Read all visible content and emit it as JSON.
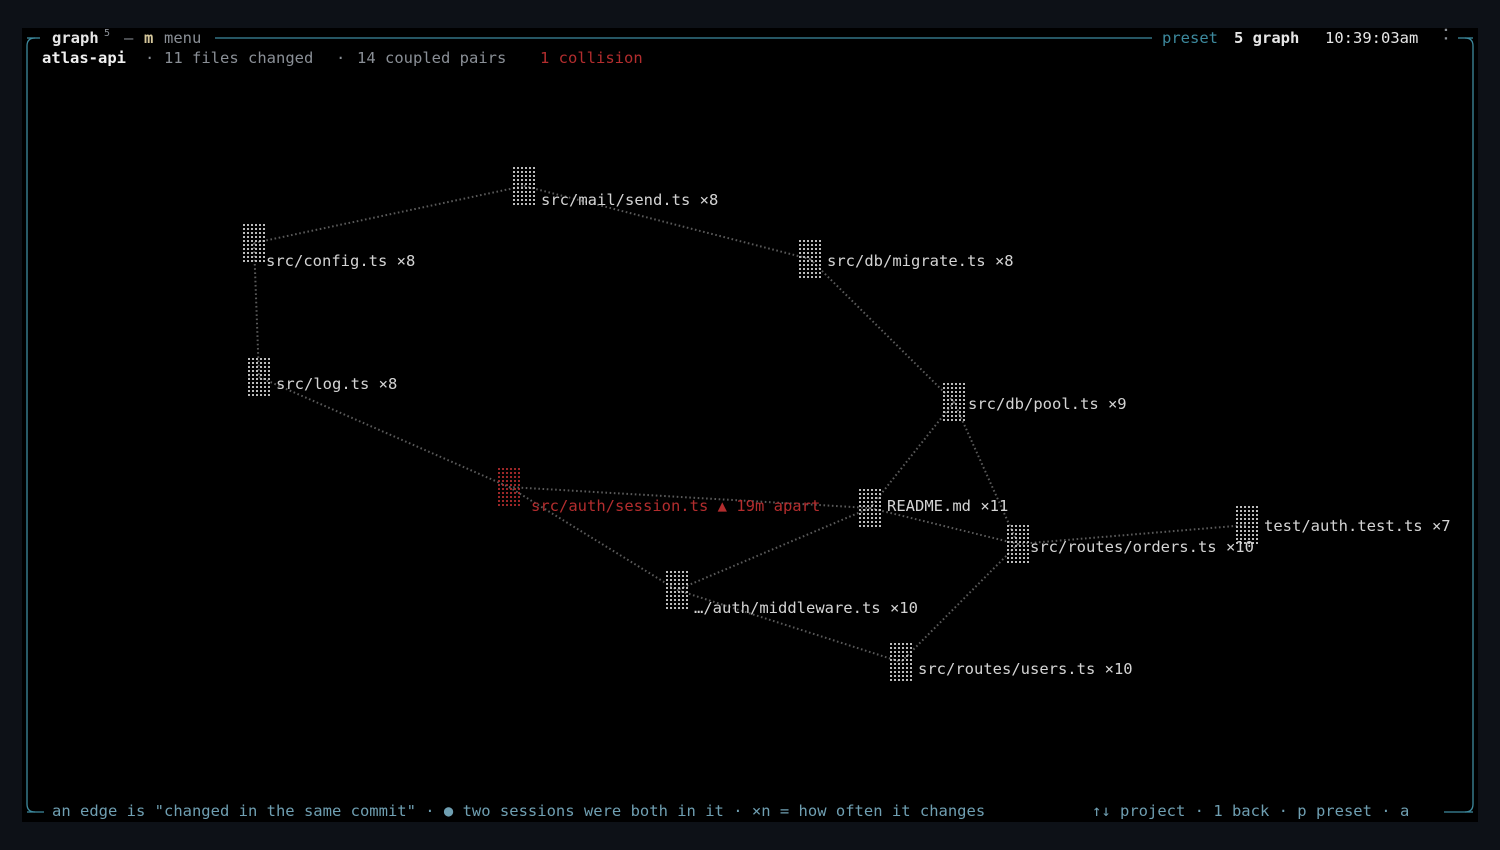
{
  "header": {
    "view_label": "graph",
    "view_sup": "5",
    "sep": "—",
    "menu_key": "m",
    "menu_label": "menu",
    "preset_label": "preset",
    "preset_value": "5 graph",
    "clock": "10:39:03am",
    "spinner": "⠨"
  },
  "status": {
    "project": "atlas-api",
    "dot1": "·",
    "files_changed": "11 files changed",
    "dot2": "·",
    "coupled_pairs": "14 coupled pairs",
    "collision": "1 collision"
  },
  "graph": {
    "nodes": [
      {
        "id": "mail_send",
        "label": "src/mail/send.ts ×8",
        "collision": false
      },
      {
        "id": "config",
        "label": "src/config.ts ×8",
        "collision": false
      },
      {
        "id": "db_migrate",
        "label": "src/db/migrate.ts ×8",
        "collision": false
      },
      {
        "id": "log",
        "label": "src/log.ts ×8",
        "collision": false
      },
      {
        "id": "db_pool",
        "label": "src/db/pool.ts ×9",
        "collision": false
      },
      {
        "id": "session",
        "label": "src/auth/session.ts ▲ 19m apart",
        "collision": true
      },
      {
        "id": "readme",
        "label": "README.md ×11",
        "collision": false
      },
      {
        "id": "auth_test",
        "label": "test/auth.test.ts ×7",
        "collision": false
      },
      {
        "id": "orders",
        "label": "src/routes/orders.ts ×10",
        "collision": false
      },
      {
        "id": "middleware",
        "label": "…/auth/middleware.ts ×10",
        "collision": false
      },
      {
        "id": "users",
        "label": "src/routes/users.ts ×10",
        "collision": false
      }
    ],
    "edges": [
      [
        "config",
        "mail_send"
      ],
      [
        "mail_send",
        "db_migrate"
      ],
      [
        "config",
        "log"
      ],
      [
        "db_migrate",
        "db_pool"
      ],
      [
        "log",
        "session"
      ],
      [
        "session",
        "middleware"
      ],
      [
        "db_pool",
        "readme"
      ],
      [
        "db_pool",
        "orders"
      ],
      [
        "readme",
        "middleware"
      ],
      [
        "readme",
        "orders"
      ],
      [
        "orders",
        "auth_test"
      ],
      [
        "orders",
        "users"
      ],
      [
        "middleware",
        "users"
      ],
      [
        "session",
        "readme"
      ]
    ]
  },
  "footer": {
    "legend": "an edge is \"changed in the same commit\" · ● two sessions were both in it · ×n = how often it changes",
    "keys": "↑↓ project · 1 back · p preset · a"
  },
  "colors": {
    "frame": "#3d8a9e",
    "text": "#d4d4d4",
    "muted": "#8a8f96",
    "accent": "#6f9fb2",
    "collision": "#b32d2e",
    "yellow": "#d6c89c",
    "edge": "#5a5a5a"
  }
}
